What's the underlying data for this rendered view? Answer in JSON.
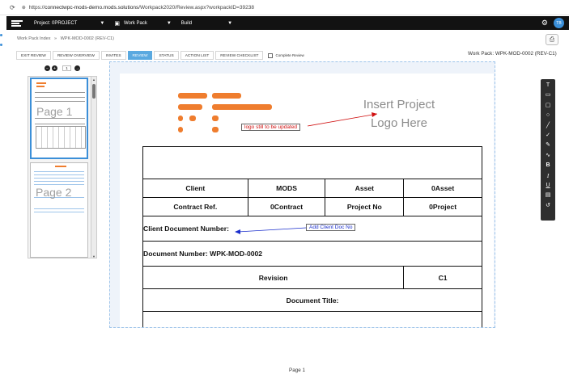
{
  "browser": {
    "reload_icon": "reload-icon",
    "url_prefix": "https://",
    "url_host": "connectwpc-mods-demo.mods.solutions",
    "url_path": "/Workpack2020/Review.aspx?workpackID=39238"
  },
  "topnav": {
    "project_label": "Project: 0PROJECT",
    "workpack_label": "Work Pack",
    "build_label": "Build",
    "avatar_initials": "TB"
  },
  "breadcrumb": {
    "root": "Work Pack Index",
    "separator": "»",
    "current": "WPK-MOD-0002 (REV-C1)"
  },
  "tabs": [
    {
      "label": "EXIT REVIEW",
      "active": false
    },
    {
      "label": "REVIEW OVERVIEW",
      "active": false
    },
    {
      "label": "INVITES",
      "active": false
    },
    {
      "label": "REVIEW",
      "active": true
    },
    {
      "label": "STATUS",
      "active": false
    },
    {
      "label": "ACTION LIST",
      "active": false
    },
    {
      "label": "REVIEW CHECKLIST",
      "active": false
    }
  ],
  "complete_review_label": "Complete Review",
  "workpack_title": "Work Pack: WPK-MOD-0002 (REV-C1)",
  "thumbnails": {
    "page_number": "1",
    "pages": [
      "Page 1",
      "Page 2"
    ]
  },
  "document": {
    "logo_placeholder_line1": "Insert Project",
    "logo_placeholder_line2": "Logo Here",
    "annotation_logo": "logo still to be updated",
    "annotation_client_doc": "Add Client Doc No",
    "client_label": "Client",
    "client_value": "MODS",
    "asset_label": "Asset",
    "asset_value": "0Asset",
    "contract_label": "Contract Ref.",
    "contract_value": "0Contract",
    "project_no_label": "Project No",
    "project_no_value": "0Project",
    "client_doc_label": "Client Document Number:",
    "doc_number": "Document Number: WPK-MOD-0002",
    "revision_label": "Revision",
    "revision_value": "C1",
    "doc_title_label": "Document Title:",
    "annotation_color_red": "#d01010",
    "annotation_color_blue": "#1a2ecc"
  },
  "toolbar_icons": [
    "text-tool-icon",
    "comment-icon",
    "rectangle-icon",
    "circle-icon",
    "line-icon",
    "check-icon",
    "edit-icon",
    "freehand-icon",
    "bold-icon",
    "italic-icon",
    "underline-icon",
    "stamp-icon",
    "undo-icon"
  ],
  "toolbar_glyphs": [
    "T",
    "▭",
    "▢",
    "○",
    "╱",
    "✓",
    "✎",
    "∿",
    "B",
    "I",
    "U",
    "▤",
    "↺"
  ],
  "footer": {
    "page_label": "Page 1"
  },
  "colors": {
    "accent": "#5aa9e0",
    "nav_bg": "#121212",
    "logo_orange": "#ef7d2e"
  }
}
